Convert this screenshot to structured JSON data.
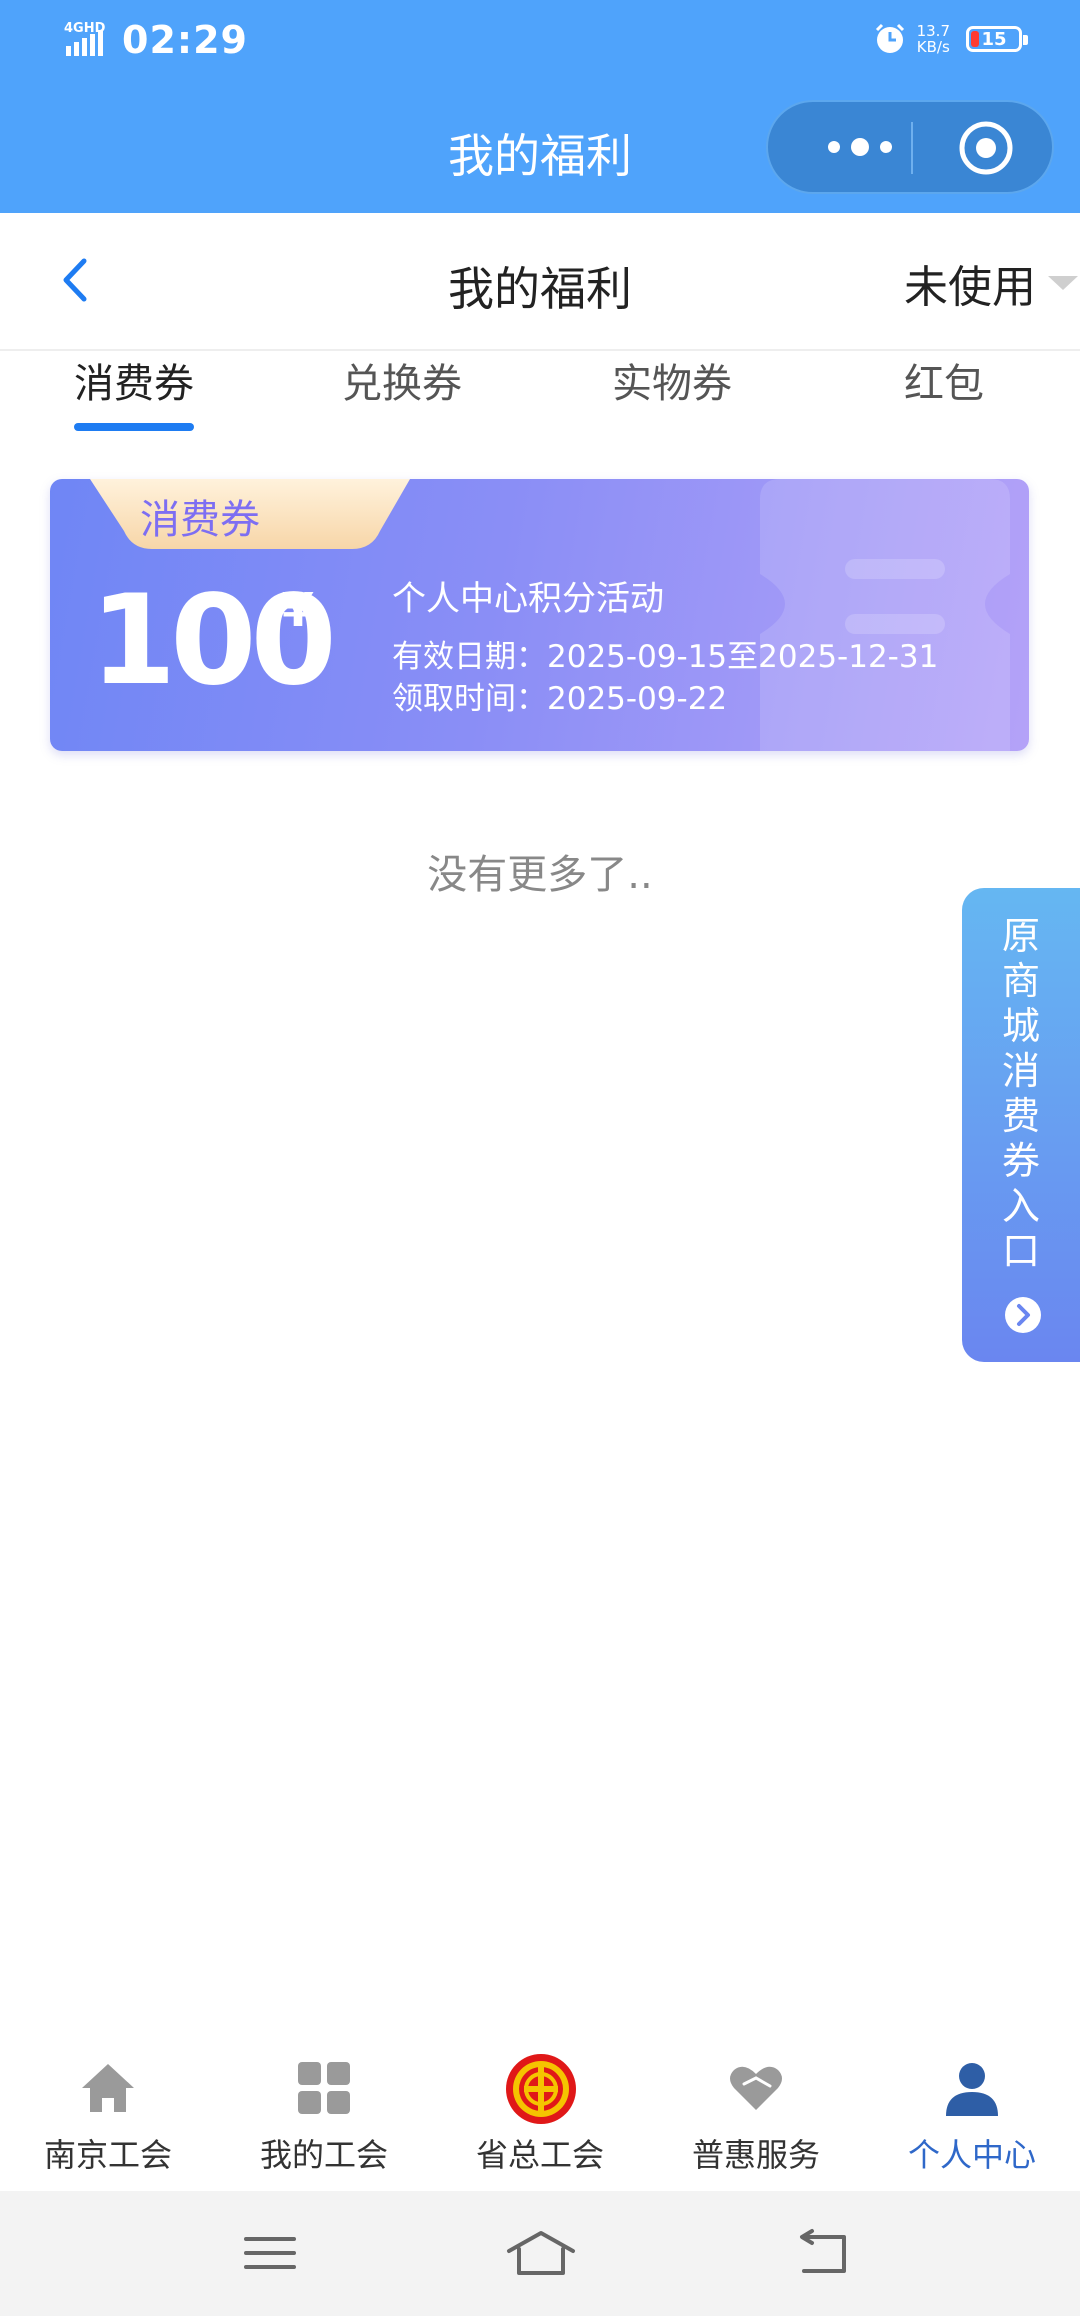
{
  "status_bar": {
    "network": "4GHD",
    "time": "02:29",
    "net_speed_value": "13.7",
    "net_speed_unit": "KB/s",
    "battery": "15"
  },
  "header": {
    "title": "我的福利"
  },
  "nav": {
    "title": "我的福利",
    "filter_label": "未使用"
  },
  "tabs": [
    {
      "label": "消费券",
      "active": true
    },
    {
      "label": "兑换券",
      "active": false
    },
    {
      "label": "实物券",
      "active": false
    },
    {
      "label": "红包",
      "active": false
    }
  ],
  "coupon": {
    "tag": "消费券",
    "amount": "100",
    "currency": "¥",
    "name": "个人中心积分活动",
    "valid_label": "有效日期：",
    "valid_value": "2025-09-15至2025-12-31",
    "claim_label": "领取时间：",
    "claim_value": "2025-09-22"
  },
  "list_end_text": "没有更多了..",
  "side_entry": {
    "text": [
      "原",
      "商",
      "城",
      "消",
      "费",
      "券",
      "入",
      "口"
    ]
  },
  "tabbar": [
    {
      "label": "南京工会",
      "icon": "home-icon"
    },
    {
      "label": "我的工会",
      "icon": "grid-icon"
    },
    {
      "label": "省总工会",
      "icon": "union-emblem-icon"
    },
    {
      "label": "普惠服务",
      "icon": "heart-icon"
    },
    {
      "label": "个人中心",
      "icon": "person-icon",
      "active": true
    }
  ],
  "colors": {
    "header": "#4fa3fb",
    "accent": "#1e7cf2",
    "active_tab": "#2f68c9",
    "coupon_start": "#6f86f5",
    "coupon_end": "#b4a2f8"
  }
}
